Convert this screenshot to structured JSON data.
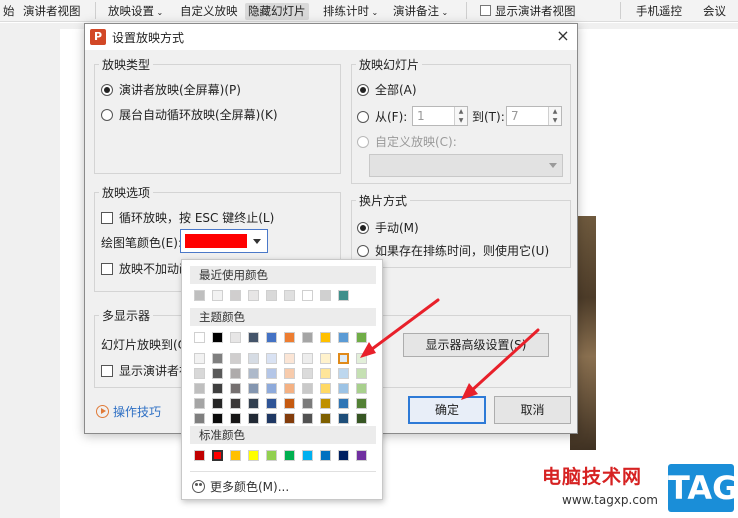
{
  "ribbon": {
    "items": [
      "始",
      "演讲者视图",
      "放映设置",
      "自定义放映",
      "隐藏幻灯片",
      "排练计时",
      "演讲备注",
      "显示演讲者视图",
      "手机遥控",
      "会议"
    ]
  },
  "dialog": {
    "title": "设置放映方式",
    "app_icon_letter": "P",
    "close_glyph": "×",
    "show_type": {
      "label": "放映类型",
      "options": [
        "演讲者放映(全屏幕)(P)",
        "展台自动循环放映(全屏幕)(K)"
      ],
      "selected": 0
    },
    "slides": {
      "label": "放映幻灯片",
      "all": "全部(A)",
      "from": "从(F):",
      "from_value": "1",
      "to": "到(T):",
      "to_value": "7",
      "custom": "自定义放映(C):"
    },
    "options": {
      "label": "放映选项",
      "loop": "循环放映，按 ESC 键终止(L)",
      "pen_color": "绘图笔颜色(E):",
      "no_anim": "放映不加动画"
    },
    "switch": {
      "label": "换片方式",
      "manual": "手动(M)",
      "timing": "如果存在排练时间，则使用它(U)"
    },
    "monitors": {
      "label": "多显示器",
      "slide_on": "幻灯片放映到(O)",
      "presenter_view": "显示演讲者视图",
      "advanced_button": "显示器高级设置(S)"
    },
    "help": "操作技巧",
    "ok": "确定",
    "cancel": "取消"
  },
  "color_popup": {
    "recent_label": "最近使用颜色",
    "theme_label": "主题颜色",
    "standard_label": "标准颜色",
    "more_colors": "更多颜色(M)...",
    "recent_colors": [
      "#bfbfbf",
      "#f2f2f2",
      "#d0cece",
      "#e7e6e6",
      "#d9d9d9",
      "#e0e0e0",
      "#ffffff",
      "#d0d0d0",
      "#3f8f8b"
    ],
    "theme_top": [
      "#ffffff",
      "#000000",
      "#e7e6e6",
      "#44546a",
      "#4472c4",
      "#ed7d31",
      "#a5a5a5",
      "#ffc000",
      "#5b9bd5",
      "#70ad47"
    ],
    "theme_shades": [
      [
        "#f2f2f2",
        "#7f7f7f",
        "#d0cece",
        "#d6dce4",
        "#d9e2f3",
        "#fbe5d5",
        "#ededed",
        "#fff2cc",
        "#deebf6",
        "#e2efd9"
      ],
      [
        "#d8d8d8",
        "#595959",
        "#aeabab",
        "#adb9ca",
        "#b4c6e7",
        "#f7cbac",
        "#dbdbdb",
        "#fee599",
        "#bdd7ee",
        "#c5e0b3"
      ],
      [
        "#bfbfbf",
        "#3f3f3f",
        "#757070",
        "#8496b0",
        "#8eaadb",
        "#f4b183",
        "#c9c9c9",
        "#ffd965",
        "#9cc3e5",
        "#a8d08d"
      ],
      [
        "#a5a5a5",
        "#262626",
        "#3a3838",
        "#323f4f",
        "#2f5496",
        "#c55a11",
        "#7b7b7b",
        "#bf9000",
        "#2e75b5",
        "#538135"
      ],
      [
        "#7f7f7f",
        "#0c0c0c",
        "#171616",
        "#222a35",
        "#1f3864",
        "#833c0b",
        "#525252",
        "#7f6000",
        "#1e4e79",
        "#375623"
      ]
    ],
    "standard_colors": [
      "#c00000",
      "#ff0000",
      "#ffc000",
      "#ffff00",
      "#92d050",
      "#00b050",
      "#00b0f0",
      "#0070c0",
      "#002060",
      "#7030a0"
    ]
  },
  "watermark": {
    "title": "电脑技术网",
    "url": "www.tagxp.com",
    "tag": "TAG"
  },
  "colors": {
    "pen_color": "#ff0000",
    "arrow": "#e8202a",
    "accent": "#2e7ad6"
  }
}
